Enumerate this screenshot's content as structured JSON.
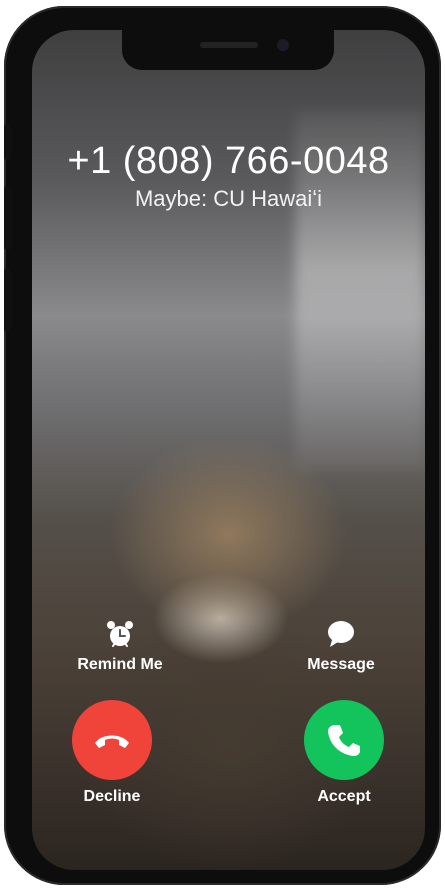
{
  "call": {
    "number": "+1 (808) 766-0048",
    "subtitle": "Maybe: CU Hawaiʻi"
  },
  "actions": {
    "remind_me": {
      "label": "Remind Me",
      "icon": "alarm-clock-icon"
    },
    "message": {
      "label": "Message",
      "icon": "speech-bubble-icon"
    },
    "decline": {
      "label": "Decline",
      "icon": "phone-hangup-icon",
      "color": "#f0433a"
    },
    "accept": {
      "label": "Accept",
      "icon": "phone-icon",
      "color": "#13c45c"
    }
  }
}
